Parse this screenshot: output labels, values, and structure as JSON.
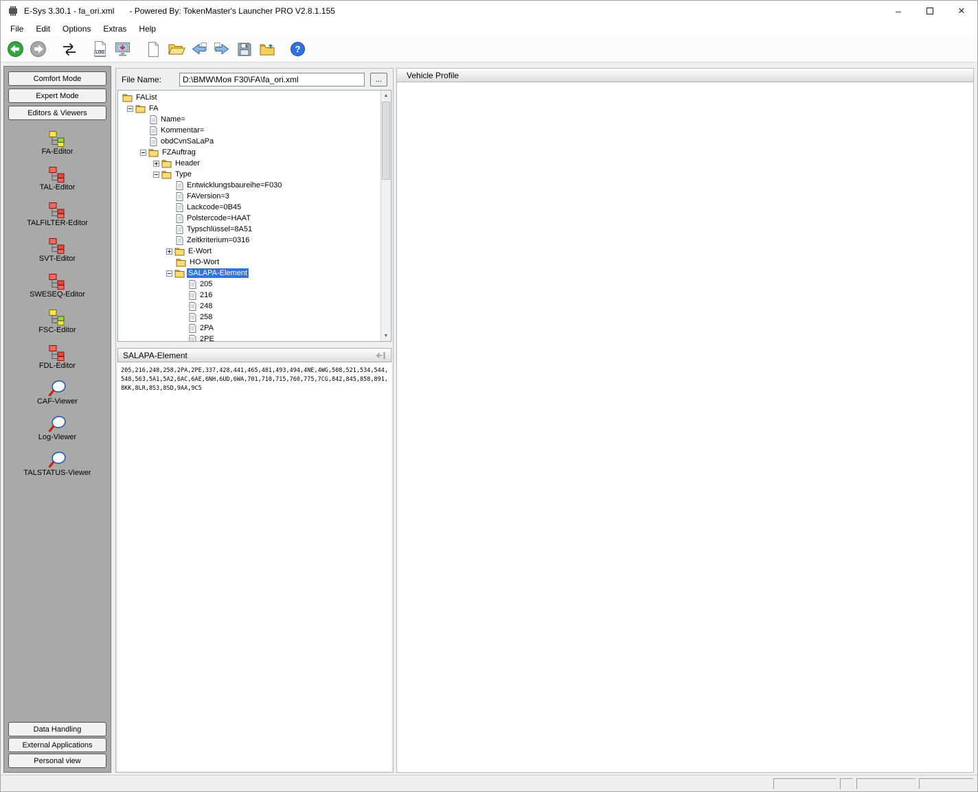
{
  "window": {
    "title_left": "E-Sys 3.30.1 - fa_ori.xml",
    "title_right": "- Powered By: TokenMaster's Launcher PRO V2.8.1.155"
  },
  "icons": {
    "minimize": "–",
    "close": "×",
    "help": "?",
    "scroll_up": "▲",
    "scroll_down": "▼"
  },
  "menu": {
    "items": [
      "File",
      "Edit",
      "Options",
      "Extras",
      "Help"
    ]
  },
  "toolbar": {
    "log_label": "LOG"
  },
  "sidebar": {
    "top_buttons": [
      "Comfort Mode",
      "Expert Mode",
      "Editors & Viewers"
    ],
    "tools": [
      {
        "label": "FA-Editor",
        "icon": "tree-yellow"
      },
      {
        "label": "TAL-Editor",
        "icon": "tree-red"
      },
      {
        "label": "TALFILTER-Editor",
        "icon": "tree-red"
      },
      {
        "label": "SVT-Editor",
        "icon": "tree-red"
      },
      {
        "label": "SWESEQ-Editor",
        "icon": "tree-red"
      },
      {
        "label": "FSC-Editor",
        "icon": "tree-yellow"
      },
      {
        "label": "FDL-Editor",
        "icon": "tree-red"
      },
      {
        "label": "CAF-Viewer",
        "icon": "magnifier"
      },
      {
        "label": "Log-Viewer",
        "icon": "magnifier"
      },
      {
        "label": "TALSTATUS-Viewer",
        "icon": "magnifier"
      }
    ],
    "bottom_buttons": [
      "Data Handling",
      "External Applications",
      "Personal view"
    ]
  },
  "file_panel": {
    "label": "File Name:",
    "value": "D:\\BMW\\Моя F30\\FA\\fa_ori.xml",
    "browse_label": "..."
  },
  "tree": {
    "nodes": [
      {
        "label": "FAList",
        "depth": 0,
        "icon": "folder",
        "expander": "none"
      },
      {
        "label": "FA",
        "depth": 1,
        "icon": "folder",
        "expander": "minus"
      },
      {
        "label": "Name=",
        "depth": 2,
        "icon": "doc",
        "expander": "none"
      },
      {
        "label": "Kommentar=",
        "depth": 2,
        "icon": "doc",
        "expander": "none"
      },
      {
        "label": "obdCvnSaLaPa",
        "depth": 2,
        "icon": "doc",
        "expander": "none"
      },
      {
        "label": "FZAuftrag",
        "depth": 2,
        "icon": "folder",
        "expander": "minus"
      },
      {
        "label": "Header",
        "depth": 3,
        "icon": "folder",
        "expander": "plus"
      },
      {
        "label": "Type",
        "depth": 3,
        "icon": "folder",
        "expander": "minus"
      },
      {
        "label": "Entwicklungsbaureihe=F030",
        "depth": 4,
        "icon": "doc",
        "expander": "none"
      },
      {
        "label": "FAVersion=3",
        "depth": 4,
        "icon": "doc",
        "expander": "none"
      },
      {
        "label": "Lackcode=0B45",
        "depth": 4,
        "icon": "doc",
        "expander": "none"
      },
      {
        "label": "Polstercode=HAAT",
        "depth": 4,
        "icon": "doc",
        "expander": "none"
      },
      {
        "label": "Typschlüssel=8A51",
        "depth": 4,
        "icon": "doc",
        "expander": "none"
      },
      {
        "label": "Zeitkriterium=0316",
        "depth": 4,
        "icon": "doc",
        "expander": "none"
      },
      {
        "label": "E-Wort",
        "depth": 4,
        "icon": "folder",
        "expander": "plus"
      },
      {
        "label": "HO-Wort",
        "depth": 4,
        "icon": "folder",
        "expander": "none"
      },
      {
        "label": "SALAPA-Element",
        "depth": 4,
        "icon": "folder",
        "expander": "minus",
        "selected": true
      },
      {
        "label": "205",
        "depth": 5,
        "icon": "doc",
        "expander": "none"
      },
      {
        "label": "216",
        "depth": 5,
        "icon": "doc",
        "expander": "none"
      },
      {
        "label": "248",
        "depth": 5,
        "icon": "doc",
        "expander": "none"
      },
      {
        "label": "258",
        "depth": 5,
        "icon": "doc",
        "expander": "none"
      },
      {
        "label": "2PA",
        "depth": 5,
        "icon": "doc",
        "expander": "none"
      },
      {
        "label": "2PE",
        "depth": 5,
        "icon": "doc",
        "expander": "none"
      }
    ]
  },
  "salapa_panel": {
    "title": "SALAPA-Element",
    "content": "205,216,248,258,2PA,2PE,337,428,441,465,481,493,494,4NE,4WG,508,521,534,544,548,563,5A1,5A2,6AC,6AE,6NH,6UD,6WA,701,710,715,760,775,7CG,842,845,858,891,8KK,8LR,8S3,8SD,9AA,9C5"
  },
  "vehicle_profile": {
    "title": "Vehicle Profile"
  },
  "colors": {
    "selection_bg": "#3273d9",
    "selection_fg": "#ffffff"
  }
}
